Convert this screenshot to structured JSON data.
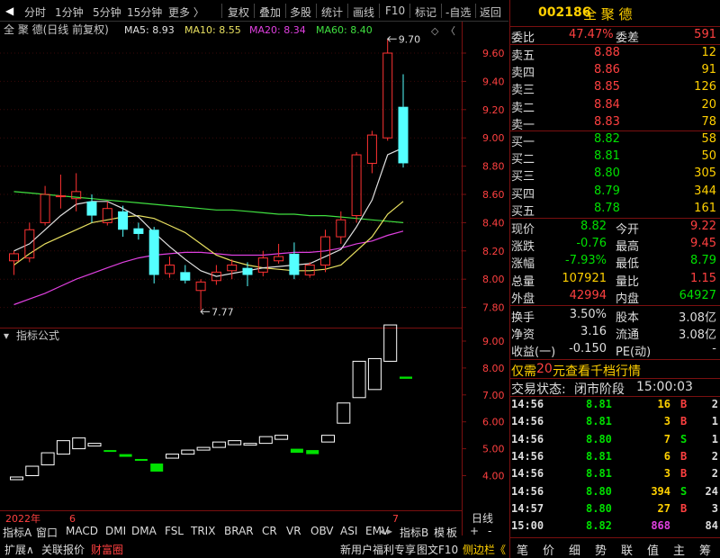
{
  "toolbar": {
    "left_items": [
      "分时",
      "1分钟",
      "5分钟",
      "15分钟",
      "更多"
    ],
    "right_items": [
      "复权",
      "叠加",
      "多股",
      "统计",
      "画线",
      "F10",
      "标记",
      "-自选",
      "返回"
    ]
  },
  "chart": {
    "title": "全 聚 德(日线 前复权)",
    "ma_labels": [
      {
        "text": "MA5: 8.93",
        "color": "#e0e0e0"
      },
      {
        "text": "MA10: 8.55",
        "color": "#e8e060"
      },
      {
        "text": "MA20: 8.34",
        "color": "#e040e0"
      },
      {
        "text": "MA60: 8.40",
        "color": "#40e040"
      }
    ],
    "high_label": "9.70",
    "low_label": "7.77",
    "price_axis": [
      "9.60",
      "9.40",
      "9.20",
      "9.00",
      "8.80",
      "8.60",
      "8.40",
      "8.20",
      "8.00",
      "7.80"
    ],
    "indicator_title": "指标公式",
    "indicator_axis": [
      "9.00",
      "8.00",
      "7.00",
      "6.00",
      "5.00",
      "4.00"
    ],
    "date_labels": [
      "2022年",
      "6",
      "7"
    ],
    "period": "日线",
    "colors": {
      "up": "#ff3232",
      "down": "#54ffff",
      "ma5": "#e0e0e0",
      "ma10": "#e8e060",
      "ma20": "#e040e0",
      "ma60": "#40e040",
      "ind_up": "#ffffff",
      "ind_down": "#00e000"
    },
    "candles": [
      {
        "o": 8.13,
        "c": 8.18,
        "h": 8.2,
        "l": 8.03
      },
      {
        "o": 8.15,
        "c": 8.35,
        "h": 8.4,
        "l": 8.12
      },
      {
        "o": 8.4,
        "c": 8.6,
        "h": 8.66,
        "l": 8.38
      },
      {
        "o": 8.59,
        "c": 8.59,
        "h": 8.74,
        "l": 8.5
      },
      {
        "o": 8.57,
        "c": 8.62,
        "h": 8.75,
        "l": 8.48
      },
      {
        "o": 8.55,
        "c": 8.45,
        "h": 8.6,
        "l": 8.4
      },
      {
        "o": 8.4,
        "c": 8.5,
        "h": 8.55,
        "l": 8.38
      },
      {
        "o": 8.48,
        "c": 8.35,
        "h": 8.52,
        "l": 8.3
      },
      {
        "o": 8.36,
        "c": 8.32,
        "h": 8.4,
        "l": 8.28
      },
      {
        "o": 8.35,
        "c": 8.03,
        "h": 8.37,
        "l": 7.97
      },
      {
        "o": 8.04,
        "c": 8.1,
        "h": 8.16,
        "l": 8.01
      },
      {
        "o": 8.05,
        "c": 7.99,
        "h": 8.1,
        "l": 7.97
      },
      {
        "o": 7.92,
        "c": 7.98,
        "h": 8.0,
        "l": 7.78
      },
      {
        "o": 7.99,
        "c": 8.05,
        "h": 8.1,
        "l": 7.96
      },
      {
        "o": 8.06,
        "c": 8.1,
        "h": 8.14,
        "l": 8.0
      },
      {
        "o": 8.08,
        "c": 8.03,
        "h": 8.12,
        "l": 7.95
      },
      {
        "o": 8.05,
        "c": 8.15,
        "h": 8.2,
        "l": 8.02
      },
      {
        "o": 8.13,
        "c": 8.16,
        "h": 8.25,
        "l": 8.11
      },
      {
        "o": 8.18,
        "c": 8.03,
        "h": 8.26,
        "l": 8.0
      },
      {
        "o": 8.03,
        "c": 8.1,
        "h": 8.12,
        "l": 8.01
      },
      {
        "o": 8.1,
        "c": 8.3,
        "h": 8.35,
        "l": 8.05
      },
      {
        "o": 8.3,
        "c": 8.42,
        "h": 8.48,
        "l": 8.25
      },
      {
        "o": 8.45,
        "c": 8.88,
        "h": 8.9,
        "l": 8.4
      },
      {
        "o": 8.82,
        "c": 9.02,
        "h": 9.05,
        "l": 8.75
      },
      {
        "o": 9.0,
        "c": 9.6,
        "h": 9.7,
        "l": 8.98
      },
      {
        "o": 9.22,
        "c": 8.82,
        "h": 9.45,
        "l": 8.79
      }
    ],
    "ma5": [
      8.2,
      8.25,
      8.35,
      8.45,
      8.53,
      8.55,
      8.55,
      8.5,
      8.44,
      8.33,
      8.23,
      8.14,
      8.06,
      8.02,
      8.04,
      8.06,
      8.08,
      8.09,
      8.1,
      8.11,
      8.16,
      8.21,
      8.37,
      8.56,
      8.88,
      8.93
    ],
    "ma10": [
      8.1,
      8.18,
      8.25,
      8.3,
      8.35,
      8.4,
      8.42,
      8.44,
      8.45,
      8.43,
      8.38,
      8.33,
      8.25,
      8.17,
      8.13,
      8.1,
      8.08,
      8.07,
      8.06,
      8.06,
      8.07,
      8.1,
      8.2,
      8.3,
      8.46,
      8.55
    ],
    "ma20": [
      7.82,
      7.86,
      7.9,
      7.95,
      8.0,
      8.04,
      8.08,
      8.12,
      8.15,
      8.17,
      8.18,
      8.19,
      8.19,
      8.18,
      8.17,
      8.17,
      8.17,
      8.18,
      8.19,
      8.19,
      8.2,
      8.22,
      8.25,
      8.27,
      8.31,
      8.34
    ],
    "ma60": [
      8.62,
      8.61,
      8.6,
      8.59,
      8.58,
      8.57,
      8.56,
      8.55,
      8.54,
      8.53,
      8.52,
      8.51,
      8.5,
      8.49,
      8.49,
      8.48,
      8.47,
      8.46,
      8.46,
      8.45,
      8.45,
      8.44,
      8.43,
      8.42,
      8.41,
      8.4
    ],
    "indicator": [
      {
        "o": 3.85,
        "c": 3.95,
        "up": true
      },
      {
        "o": 4.0,
        "c": 4.35,
        "up": true
      },
      {
        "o": 4.4,
        "c": 4.85,
        "up": true
      },
      {
        "o": 4.8,
        "c": 5.3,
        "up": true
      },
      {
        "o": 5.0,
        "c": 5.4,
        "up": true
      },
      {
        "o": 5.1,
        "c": 5.2,
        "up": true
      },
      {
        "o": 4.95,
        "c": 4.93,
        "up": false
      },
      {
        "o": 4.8,
        "c": 4.7,
        "up": false
      },
      {
        "o": 4.62,
        "c": 4.55,
        "up": false
      },
      {
        "o": 4.45,
        "c": 4.15,
        "up": false
      },
      {
        "o": 4.65,
        "c": 4.8,
        "up": true
      },
      {
        "o": 4.8,
        "c": 4.95,
        "up": true
      },
      {
        "o": 4.95,
        "c": 5.05,
        "up": true
      },
      {
        "o": 5.05,
        "c": 5.25,
        "up": true
      },
      {
        "o": 5.15,
        "c": 5.3,
        "up": true
      },
      {
        "o": 5.15,
        "c": 5.2,
        "up": true
      },
      {
        "o": 5.2,
        "c": 5.45,
        "up": true
      },
      {
        "o": 5.35,
        "c": 5.5,
        "up": true
      },
      {
        "o": 5.0,
        "c": 4.85,
        "up": false
      },
      {
        "o": 4.95,
        "c": 4.8,
        "up": false
      },
      {
        "o": 5.25,
        "c": 5.5,
        "up": true
      },
      {
        "o": 5.95,
        "c": 6.7,
        "up": true
      },
      {
        "o": 6.9,
        "c": 8.25,
        "up": true
      },
      {
        "o": 7.2,
        "c": 8.35,
        "up": true
      },
      {
        "o": 8.25,
        "c": 9.6,
        "up": true
      },
      {
        "o": 7.68,
        "c": 7.6,
        "up": false
      }
    ]
  },
  "bottom": {
    "tabs": [
      "指标A",
      "窗口",
      "MACD",
      "DMI",
      "DMA",
      "FSL",
      "TRIX",
      "BRAR",
      "CR",
      "VR",
      "OBV",
      "ASI",
      "EMV"
    ],
    "tabs_right": [
      "指标B",
      "模",
      "板",
      "+",
      "-"
    ],
    "status": [
      "扩展∧",
      "关联报价",
      "财富圈"
    ],
    "status_right": [
      "新用户福利专享",
      "图文F10",
      "侧边栏《"
    ]
  },
  "quote": {
    "code": "002186",
    "name": "全 聚 德",
    "wei_bi_label": "委比",
    "wei_bi": "47.47%",
    "wei_cha_label": "委差",
    "wei_cha": "591",
    "asks": [
      {
        "label": "卖五",
        "price": "8.88",
        "vol": "12"
      },
      {
        "label": "卖四",
        "price": "8.86",
        "vol": "91"
      },
      {
        "label": "卖三",
        "price": "8.85",
        "vol": "126"
      },
      {
        "label": "卖二",
        "price": "8.84",
        "vol": "20"
      },
      {
        "label": "卖一",
        "price": "8.83",
        "vol": "78"
      }
    ],
    "bids": [
      {
        "label": "买一",
        "price": "8.82",
        "vol": "58"
      },
      {
        "label": "买二",
        "price": "8.81",
        "vol": "50"
      },
      {
        "label": "买三",
        "price": "8.80",
        "vol": "305"
      },
      {
        "label": "买四",
        "price": "8.79",
        "vol": "344"
      },
      {
        "label": "买五",
        "price": "8.78",
        "vol": "161"
      }
    ],
    "stats": [
      {
        "l1": "现价",
        "v1": "8.82",
        "c1": "#00e000",
        "l2": "今开",
        "v2": "9.22",
        "c2": "#ff4040"
      },
      {
        "l1": "涨跌",
        "v1": "-0.76",
        "c1": "#00e000",
        "l2": "最高",
        "v2": "9.45",
        "c2": "#ff4040"
      },
      {
        "l1": "涨幅",
        "v1": "-7.93%",
        "c1": "#00e000",
        "l2": "最低",
        "v2": "8.79",
        "c2": "#00e000"
      },
      {
        "l1": "总量",
        "v1": "107921",
        "c1": "#ffd000",
        "l2": "量比",
        "v2": "1.15",
        "c2": "#ff4040"
      },
      {
        "l1": "外盘",
        "v1": "42994",
        "c1": "#ff4040",
        "l2": "内盘",
        "v2": "64927",
        "c2": "#00e000"
      }
    ],
    "finance": [
      {
        "l1": "换手",
        "v1": "3.50%",
        "l2": "股本",
        "v2": "3.08亿"
      },
      {
        "l1": "净资",
        "v1": "3.16",
        "l2": "流通",
        "v2": "3.08亿"
      },
      {
        "l1": "收益(一)",
        "v1": "-0.150",
        "l2": "PE(动)",
        "v2": "-"
      }
    ],
    "promo_pre": "仅需",
    "promo_num": "20",
    "promo_post": "元查看千档行情",
    "trade_state_label": "交易状态:",
    "trade_state": "闭市阶段",
    "trade_time": "15:00:03",
    "ticks": [
      {
        "time": "14:56",
        "price": "8.81",
        "vol": "16",
        "side": "B",
        "cnt": "2"
      },
      {
        "time": "14:56",
        "price": "8.81",
        "vol": "3",
        "side": "B",
        "cnt": "1"
      },
      {
        "time": "14:56",
        "price": "8.80",
        "vol": "7",
        "side": "S",
        "cnt": "1"
      },
      {
        "time": "14:56",
        "price": "8.81",
        "vol": "6",
        "side": "B",
        "cnt": "2"
      },
      {
        "time": "14:56",
        "price": "8.81",
        "vol": "3",
        "side": "B",
        "cnt": "2"
      },
      {
        "time": "14:56",
        "price": "8.80",
        "vol": "394",
        "side": "S",
        "cnt": "24"
      },
      {
        "time": "14:57",
        "price": "8.80",
        "vol": "27",
        "side": "B",
        "cnt": "3"
      },
      {
        "time": "15:00",
        "price": "8.82",
        "vol": "868",
        "side": "",
        "cnt": "84"
      }
    ],
    "buttons": [
      "笔",
      "价",
      "细",
      "势",
      "联",
      "值",
      "主",
      "筹"
    ]
  }
}
